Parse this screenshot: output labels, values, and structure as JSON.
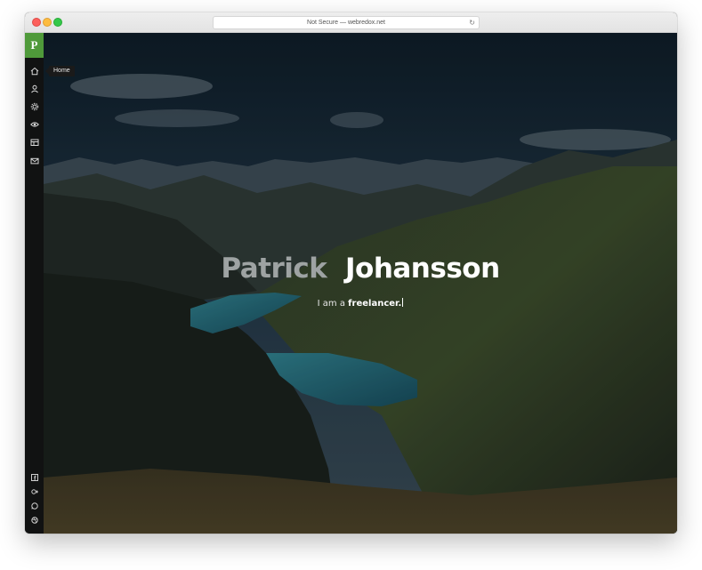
{
  "browser": {
    "address_text": "Not Secure — webredox.net",
    "reload_glyph": "↻"
  },
  "sidebar": {
    "logo_letter": "P",
    "tooltip": "Home",
    "nav_icons": [
      "home-icon",
      "user-icon",
      "gear-icon",
      "eye-icon",
      "portfolio-icon",
      "mail-icon"
    ],
    "social_icons": [
      "facebook-icon",
      "google-plus-icon",
      "whatsapp-icon",
      "dribbble-icon"
    ],
    "accent_color": "#4f9a3a"
  },
  "hero": {
    "first_name": "Patrick",
    "last_name": "Johansson",
    "intro": "I am a",
    "role": "freelancer."
  }
}
